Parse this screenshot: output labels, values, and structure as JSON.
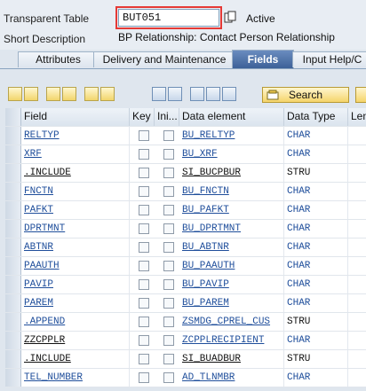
{
  "header": {
    "table_label": "Transparent Table",
    "table_name": "BUT051",
    "status": "Active",
    "short_desc_label": "Short Description",
    "short_desc": "BP Relationship: Contact Person Relationship"
  },
  "tabs": [
    "Attributes",
    "Delivery and Maintenance",
    "Fields",
    "Input Help/C"
  ],
  "active_tab": "Fields",
  "toolbar": {
    "search_label": "Search"
  },
  "columns": [
    "Field",
    "Key",
    "Ini...",
    "Data element",
    "Data Type",
    "Len"
  ],
  "rows": [
    {
      "field": "RELTYP",
      "key": false,
      "ini": false,
      "element": "BU_RELTYP",
      "type": "CHAR",
      "link": true
    },
    {
      "field": "XRF",
      "key": false,
      "ini": false,
      "element": "BU_XRF",
      "type": "CHAR",
      "link": true
    },
    {
      "field": ".INCLUDE",
      "key": false,
      "ini": false,
      "element": "SI_BUCPBUR",
      "type": "STRU",
      "link": false
    },
    {
      "field": "FNCTN",
      "key": false,
      "ini": false,
      "element": "BU_FNCTN",
      "type": "CHAR",
      "link": true
    },
    {
      "field": "PAFKT",
      "key": false,
      "ini": false,
      "element": "BU_PAFKT",
      "type": "CHAR",
      "link": true
    },
    {
      "field": "DPRTMNT",
      "key": false,
      "ini": false,
      "element": "BU_DPRTMNT",
      "type": "CHAR",
      "link": true
    },
    {
      "field": "ABTNR",
      "key": false,
      "ini": false,
      "element": "BU_ABTNR",
      "type": "CHAR",
      "link": true
    },
    {
      "field": "PAAUTH",
      "key": false,
      "ini": false,
      "element": "BU_PAAUTH",
      "type": "CHAR",
      "link": true
    },
    {
      "field": "PAVIP",
      "key": false,
      "ini": false,
      "element": "BU_PAVIP",
      "type": "CHAR",
      "link": true
    },
    {
      "field": "PAREM",
      "key": false,
      "ini": false,
      "element": "BU_PAREM",
      "type": "CHAR",
      "link": true
    },
    {
      "field": ".APPEND",
      "key": false,
      "ini": false,
      "element": "ZSMDG_CPREL_CUS",
      "type": "STRU",
      "link": true
    },
    {
      "field": "ZZCPPLR",
      "key": false,
      "ini": false,
      "element": "ZCPPLRECIPIENT",
      "type": "CHAR",
      "link": false
    },
    {
      "field": ".INCLUDE",
      "key": false,
      "ini": false,
      "element": "SI_BUADBUR",
      "type": "STRU",
      "link": false
    },
    {
      "field": "TEL_NUMBER",
      "key": false,
      "ini": false,
      "element": "AD_TLNMBR",
      "type": "CHAR",
      "link": true
    }
  ],
  "colors": {
    "link": "#1f4e9b",
    "active_tab": "#3d6198",
    "highlight": "#ebf514",
    "required_outline": "#e53935"
  },
  "icons": [
    "copy-icon",
    "cut-icon",
    "copy-rows-icon",
    "insert-row-icon",
    "delete-row-icon",
    "filter-icon",
    "first-page-icon",
    "sort-icon",
    "search-icon"
  ]
}
